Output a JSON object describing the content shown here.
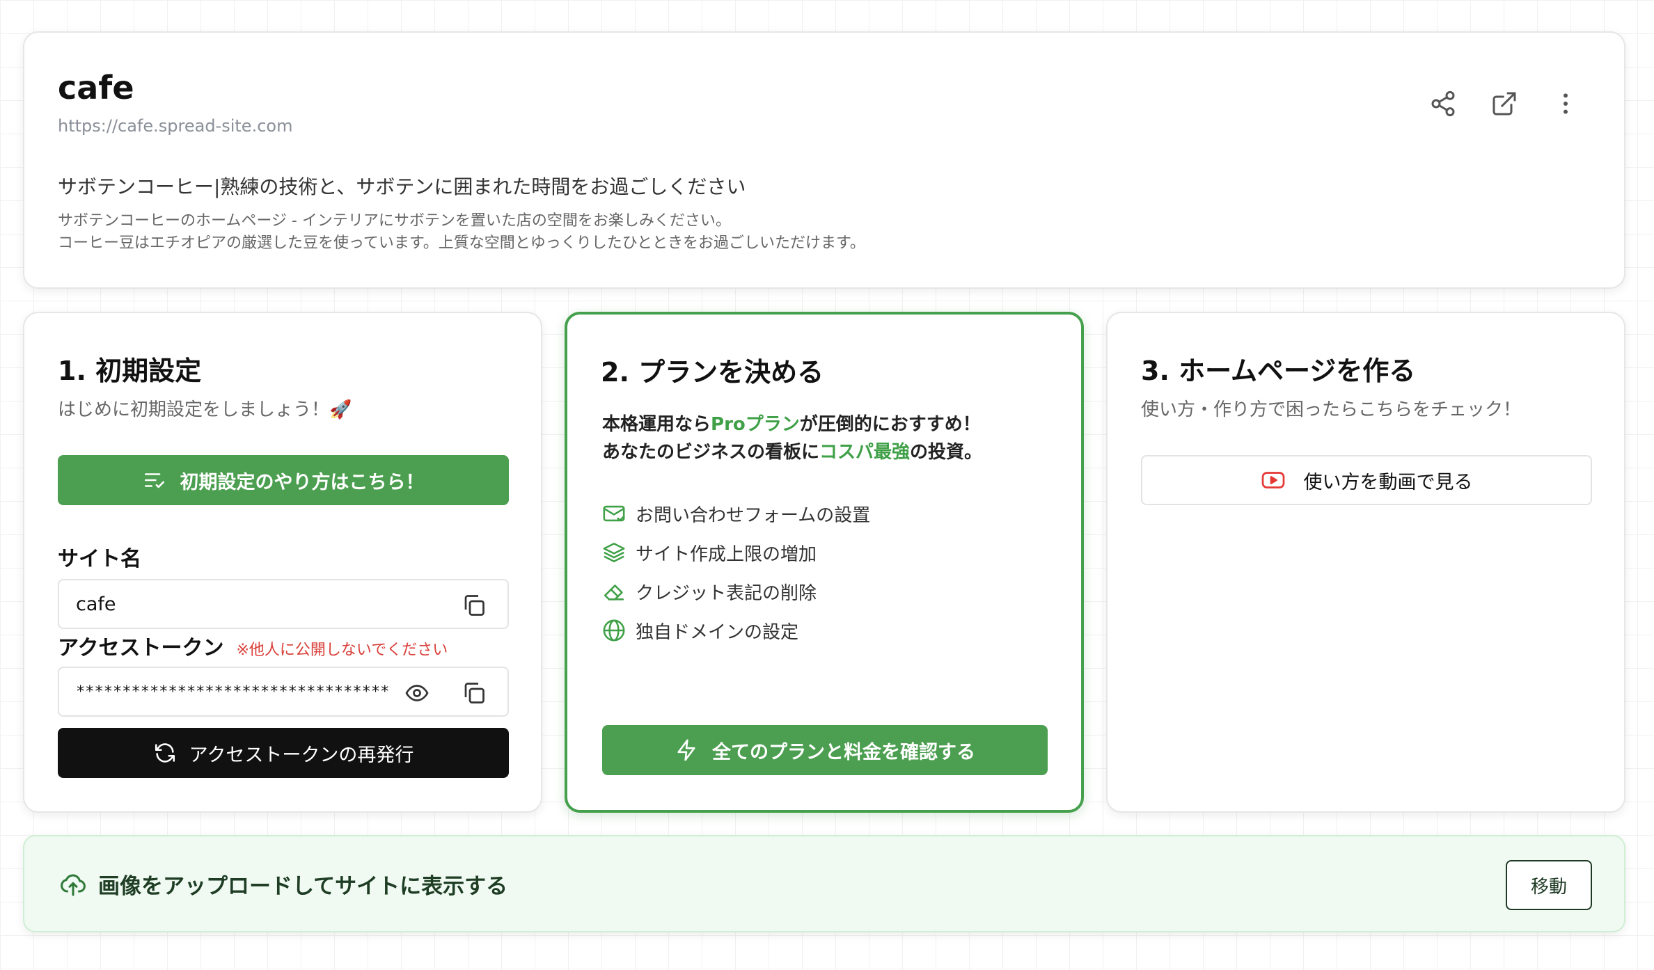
{
  "site": {
    "title": "cafe",
    "url": "https://cafe.spread-site.com",
    "headline": "サボテンコーヒー|熟練の技術と、サボテンに囲まれた時間をお過ごしください",
    "description_line1": "サボテンコーヒーのホームページ - インテリアにサボテンを置いた店の空間をお楽しみください。",
    "description_line2": "コーヒー豆はエチオピアの厳選した豆を使っています。上質な空間とゆっくりしたひとときをお過ごしいただけます。",
    "icons": [
      "share-icon",
      "external-link-icon",
      "more-vertical-icon"
    ]
  },
  "step1": {
    "title": "1. 初期設定",
    "subtitle": "はじめに初期設定をしましょう！🚀",
    "guide_button": "初期設定のやり方はこちら！",
    "site_name_label": "サイト名",
    "site_name_value": "cafe",
    "token_label": "アクセストークン",
    "token_warning": "※他人に公開しないでください",
    "token_value": "**********************************",
    "reissue_button": "アクセストークンの再発行"
  },
  "step2": {
    "title": "2. プランを決める",
    "promo_line1_a": "本格運用なら",
    "promo_line1_b": "Proプラン",
    "promo_line1_c": "が圧倒的におすすめ！",
    "promo_line2_a": "あなたのビジネスの看板に",
    "promo_line2_b": "コスパ最強",
    "promo_line2_c": "の投資。",
    "features": [
      {
        "label": "お問い合わせフォームの設置",
        "icon": "mail-icon"
      },
      {
        "label": "サイト作成上限の増加",
        "icon": "layers-icon"
      },
      {
        "label": "クレジット表記の削除",
        "icon": "eraser-icon"
      },
      {
        "label": "独自ドメインの設定",
        "icon": "globe-icon"
      }
    ],
    "plans_button": "全てのプランと料金を確認する"
  },
  "step3": {
    "title": "3. ホームページを作る",
    "subtitle": "使い方・作り方で困ったらこちらをチェック！",
    "video_button": "使い方を動画で見る"
  },
  "upload": {
    "label": "画像をアップロードしてサイトに表示する",
    "move_button": "移動"
  },
  "colors": {
    "accent_green": "#4c9f50",
    "warning_red": "#d9403a",
    "youtube_red": "#e53935"
  }
}
